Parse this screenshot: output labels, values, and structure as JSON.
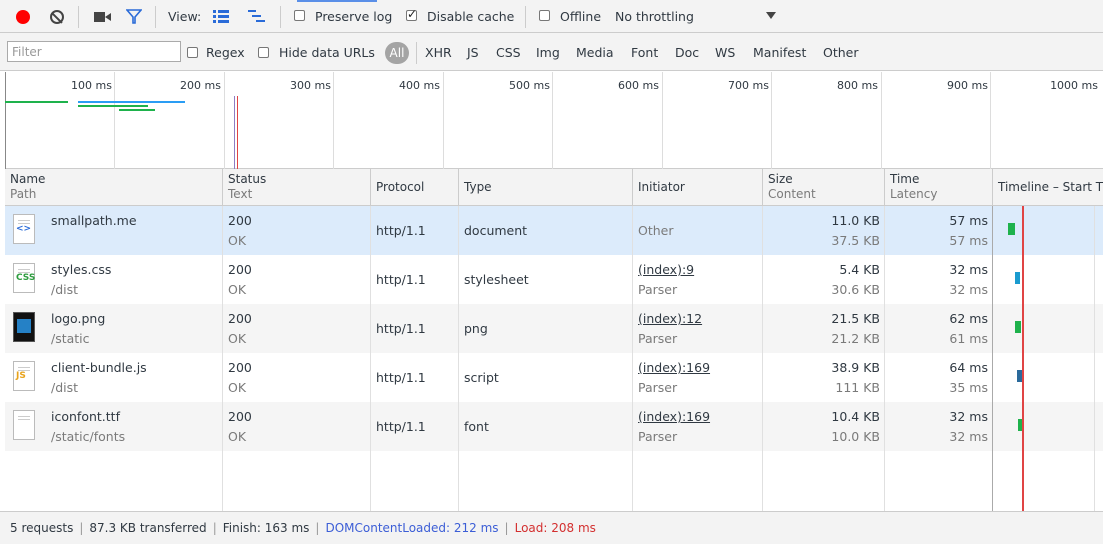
{
  "toolbar": {
    "view_label": "View:",
    "preserve_log": "Preserve log",
    "disable_cache": "Disable cache",
    "offline": "Offline",
    "throttling": "No throttling"
  },
  "filterbar": {
    "placeholder": "Filter",
    "regex": "Regex",
    "hide_data_urls": "Hide data URLs",
    "types": [
      "All",
      "XHR",
      "JS",
      "CSS",
      "Img",
      "Media",
      "Font",
      "Doc",
      "WS",
      "Manifest",
      "Other"
    ]
  },
  "overview": {
    "ticks": [
      "100 ms",
      "200 ms",
      "300 ms",
      "400 ms",
      "500 ms",
      "600 ms",
      "700 ms",
      "800 ms",
      "900 ms",
      "1000 ms"
    ],
    "colors": {
      "green": "#1eb24c",
      "blue": "#2a9df4",
      "purple": "#8e7cc3",
      "red": "#e04444"
    }
  },
  "columns": {
    "name": "Name",
    "name_sub": "Path",
    "status": "Status",
    "status_sub": "Text",
    "protocol": "Protocol",
    "type": "Type",
    "initiator": "Initiator",
    "size": "Size",
    "size_sub": "Content",
    "time": "Time",
    "time_sub": "Latency",
    "timeline": "Timeline – Start Time"
  },
  "requests": [
    {
      "name": "smallpath.me",
      "path": "",
      "status": "200",
      "status_text": "OK",
      "protocol": "http/1.1",
      "type": "document",
      "initiator": "Other",
      "initiator_sub": "",
      "size": "11.0 KB",
      "content": "37.5 KB",
      "time": "57 ms",
      "latency": "57 ms",
      "icon": "html-icon"
    },
    {
      "name": "styles.css",
      "path": "/dist",
      "status": "200",
      "status_text": "OK",
      "protocol": "http/1.1",
      "type": "stylesheet",
      "initiator": "(index):9",
      "initiator_sub": "Parser",
      "size": "5.4 KB",
      "content": "30.6 KB",
      "time": "32 ms",
      "latency": "32 ms",
      "icon": "css-icon"
    },
    {
      "name": "logo.png",
      "path": "/static",
      "status": "200",
      "status_text": "OK",
      "protocol": "http/1.1",
      "type": "png",
      "initiator": "(index):12",
      "initiator_sub": "Parser",
      "size": "21.5 KB",
      "content": "21.2 KB",
      "time": "62 ms",
      "latency": "61 ms",
      "icon": "image-icon"
    },
    {
      "name": "client-bundle.js",
      "path": "/dist",
      "status": "200",
      "status_text": "OK",
      "protocol": "http/1.1",
      "type": "script",
      "initiator": "(index):169",
      "initiator_sub": "Parser",
      "size": "38.9 KB",
      "content": "111 KB",
      "time": "64 ms",
      "latency": "35 ms",
      "icon": "js-icon"
    },
    {
      "name": "iconfont.ttf",
      "path": "/static/fonts",
      "status": "200",
      "status_text": "OK",
      "protocol": "http/1.1",
      "type": "font",
      "initiator": "(index):169",
      "initiator_sub": "Parser",
      "size": "10.4 KB",
      "content": "10.0 KB",
      "time": "32 ms",
      "latency": "32 ms",
      "icon": "font-icon"
    }
  ],
  "status_bar": {
    "requests": "5 requests",
    "transferred": "87.3 KB transferred",
    "finish": "Finish: 163 ms",
    "dom_content_loaded": "DOMContentLoaded: 212 ms",
    "load": "Load: 208 ms"
  }
}
